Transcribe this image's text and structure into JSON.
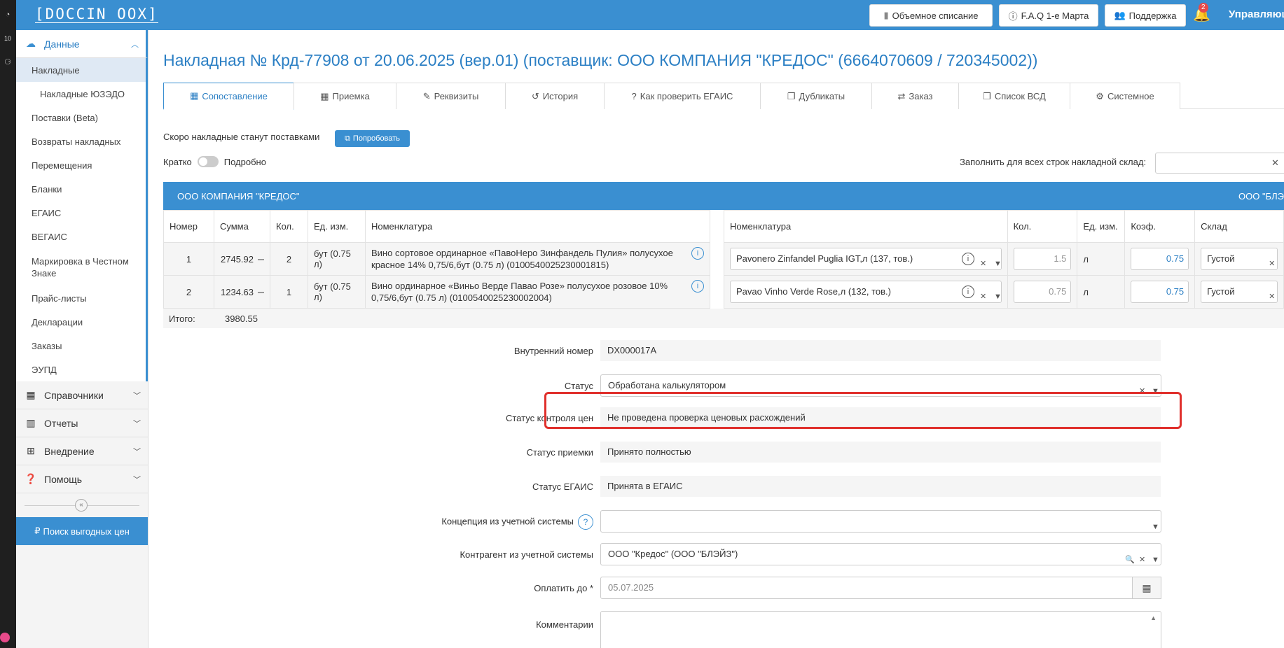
{
  "rail": {
    "icon1": "◔",
    "icon2": "10",
    "icon3": "⚆"
  },
  "topbar": {
    "logo": "[DOCCIN OOX]",
    "bulk_writeoff": "Объемное списание",
    "faq": "F.A.Q 1-е Марта",
    "support": "Поддержка",
    "notification_count": "2",
    "user": "Управляющий"
  },
  "sidebar": {
    "data_section": "Данные",
    "items": [
      {
        "label": "Накладные"
      },
      {
        "label": "Накладные ЮЗЭДО"
      },
      {
        "label": "Поставки (Beta)"
      },
      {
        "label": "Возвраты накладных"
      },
      {
        "label": "Перемещения"
      },
      {
        "label": "Бланки"
      },
      {
        "label": "ЕГАИС"
      },
      {
        "label": "ВЕГАИС"
      },
      {
        "label": "Маркировка в Честном Знаке"
      },
      {
        "label": "Прайс-листы"
      },
      {
        "label": "Декларации"
      },
      {
        "label": "Заказы"
      },
      {
        "label": "ЭУПД"
      }
    ],
    "references": "Справочники",
    "reports": "Отчеты",
    "implementation": "Внедрение",
    "help": "Помощь",
    "find_prices": "Поиск выгодных цен"
  },
  "page": {
    "title": "Накладная № Крд-77908 от 20.06.2025 (вер.01) (поставщик: ООО КОМПАНИЯ \"КРЕДОС\" (6664070609 / 720345002))",
    "tabs": [
      {
        "label": "Сопоставление",
        "icon": "▦"
      },
      {
        "label": "Приемка",
        "icon": "▦"
      },
      {
        "label": "Реквизиты",
        "icon": "✎"
      },
      {
        "label": "История",
        "icon": "↺"
      },
      {
        "label": "Как проверить ЕГАИС",
        "icon": "?"
      },
      {
        "label": "Дубликаты",
        "icon": "❐"
      },
      {
        "label": "Заказ",
        "icon": "⇄"
      },
      {
        "label": "Список ВСД",
        "icon": "❐"
      },
      {
        "label": "Системное",
        "icon": "⚙"
      }
    ],
    "soon_text": "Скоро накладные станут поставками",
    "try_button": "Попробовать",
    "short_label": "Кратко",
    "detailed_label": "Подробно",
    "fill_all_label": "Заполнить для всех строк накладной склад:",
    "supplier_name": "ООО КОМПАНИЯ \"КРЕДОС\"",
    "buyer_name": "ООО \"БЛЭЙЗ\""
  },
  "left_table": {
    "headers": [
      "Номер",
      "Сумма",
      "Кол.",
      "Ед. изм.",
      "Номенклатура"
    ],
    "rows": [
      {
        "num": "1",
        "sum": "2745.92",
        "qty": "2",
        "unit": "бут (0.75 л)",
        "name": "Вино сортовое ординарное «ПавоНеро Зинфандель Пулия» полусухое красное 14% 0,75/6,бут (0.75 л) (0100540025230001815)"
      },
      {
        "num": "2",
        "sum": "1234.63",
        "qty": "1",
        "unit": "бут (0.75 л)",
        "name": "Вино ординарное «Виньо Верде Павао Розе» полусухое розовое 10% 0,75/6,бут (0.75 л) (0100540025230002004)"
      }
    ],
    "total_label": "Итого:",
    "total_value": "3980.55"
  },
  "right_table": {
    "headers": [
      "Номенклатура",
      "Кол.",
      "Ед. изм.",
      "Коэф.",
      "Склад"
    ],
    "rows": [
      {
        "name": "Pavonero Zinfandel Puglia IGT,л (137, тов.)",
        "qty": "1.5",
        "unit": "л",
        "coef": "0.75",
        "warehouse": "Густой"
      },
      {
        "name": "Pavao Vinho Verde Rose,л (132, тов.)",
        "qty": "0.75",
        "unit": "л",
        "coef": "0.75",
        "warehouse": "Густой"
      }
    ]
  },
  "form": {
    "internal_number_label": "Внутренний номер",
    "internal_number": "DX000017A",
    "status_label": "Статус",
    "status": "Обработана калькулятором",
    "price_control_label": "Статус контроля цен",
    "price_control": "Не проведена проверка ценовых расхождений",
    "acceptance_label": "Статус приемки",
    "acceptance": "Принято полностью",
    "egais_label": "Статус ЕГАИС",
    "egais": "Принята в ЕГАИС",
    "concept_label": "Концепция из учетной системы",
    "concept": "",
    "counterparty_label": "Контрагент из учетной системы",
    "counterparty": "ООО \"Кредос\" (ООО \"БЛЭЙЗ\")",
    "pay_until_label": "Оплатить до",
    "pay_until": "05.07.2025",
    "comment_label": "Комментарии"
  }
}
